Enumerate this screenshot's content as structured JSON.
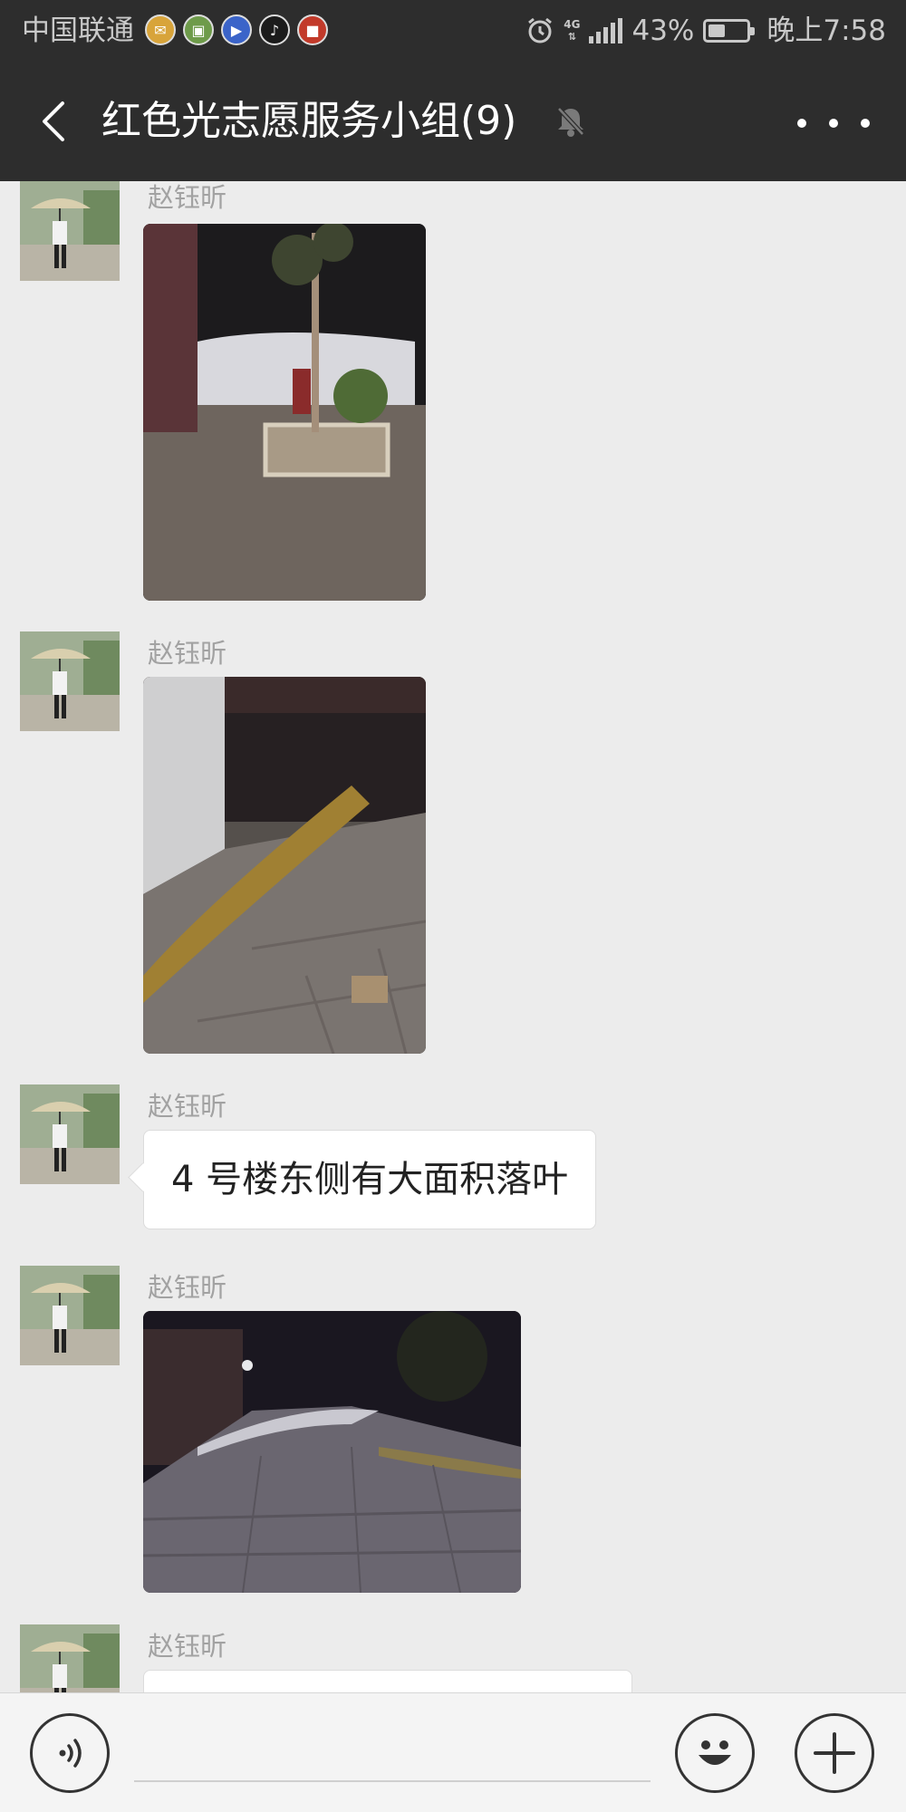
{
  "status_bar": {
    "carrier": "中国联通",
    "app_icons": [
      {
        "icon": "mail-app-icon",
        "color": "#d8a43a"
      },
      {
        "icon": "news-app-icon",
        "color": "#6e9b4a"
      },
      {
        "icon": "video-app-icon",
        "color": "#3b64c9"
      },
      {
        "icon": "tiktok-app-icon",
        "color": "#1b1b1b"
      },
      {
        "icon": "store-app-icon",
        "color": "#c23a2a"
      }
    ],
    "network": "4G",
    "battery_percent": "43%",
    "battery_level": 0.43,
    "time": "晚上7:58"
  },
  "header": {
    "title": "红色光志愿服务小组(9)",
    "muted": true
  },
  "messages": [
    {
      "type": "image",
      "sender": "赵钰昕",
      "photo": "night-tree-courtyard"
    },
    {
      "type": "image",
      "sender": "赵钰昕",
      "photo": "fallen-leaves-alley"
    },
    {
      "type": "text",
      "sender": "赵钰昕",
      "text": "4 号楼东侧有大面积落叶"
    },
    {
      "type": "image",
      "sender": "赵钰昕",
      "photo": "dark-lane-night"
    },
    {
      "type": "text",
      "sender": "赵钰昕",
      "text": ""
    }
  ],
  "input": {
    "value": "",
    "placeholder": ""
  },
  "colors": {
    "header_bg": "#2d2d2d",
    "chat_bg": "#ececec",
    "bubble_bg": "#ffffff",
    "sender_name": "#a2a2a2"
  }
}
